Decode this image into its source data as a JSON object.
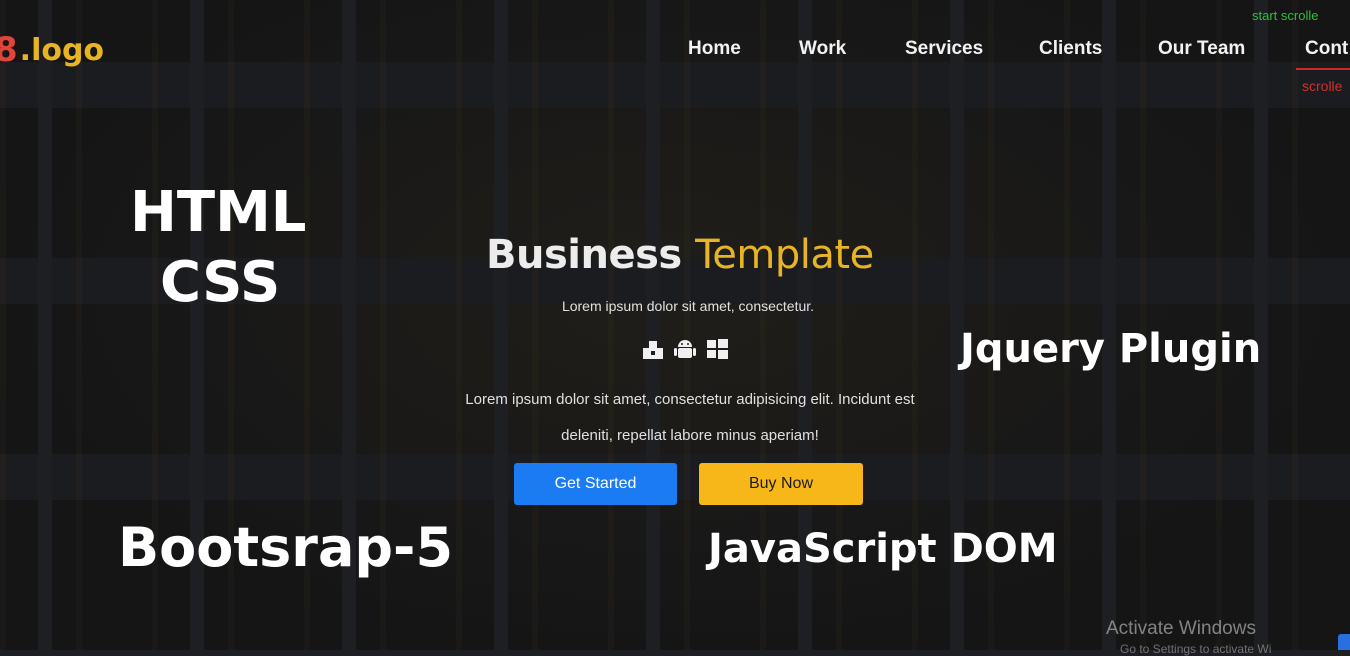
{
  "logo": {
    "mark": "8",
    "text": ".logo"
  },
  "nav": {
    "items": [
      {
        "label": "Home"
      },
      {
        "label": "Work"
      },
      {
        "label": "Services"
      },
      {
        "label": "Clients"
      },
      {
        "label": "Our Team"
      },
      {
        "label": "Cont"
      }
    ]
  },
  "corner": {
    "start": "start   scrolle",
    "scrolled": "scrolle"
  },
  "tags": {
    "html": "HTML",
    "css": "CSS",
    "bootstrap": "Bootsrap-5",
    "jquery": "Jquery Plugin",
    "javascript": "JavaScript DOM"
  },
  "hero": {
    "title_part1": "Business",
    "title_part2": "Template",
    "subtitle": "Lorem ipsum dolor sit amet, consectetur.",
    "icons": [
      "apple-icon",
      "android-icon",
      "windows-icon"
    ],
    "description_line1": "Lorem ipsum dolor sit amet, consectetur adipisicing elit. Incidunt est",
    "description_line2": "deleniti, repellat labore minus aperiam!"
  },
  "buttons": {
    "get_started": "Get Started",
    "buy_now": "Buy Now"
  },
  "watermark": {
    "title": "Activate Windows",
    "subtitle": "Go to Settings to activate Wi"
  },
  "colors": {
    "accent_yellow": "#e8b423",
    "button_blue": "#1a7bf2",
    "button_yellow": "#f7b718",
    "logo_red": "#e0443a"
  }
}
